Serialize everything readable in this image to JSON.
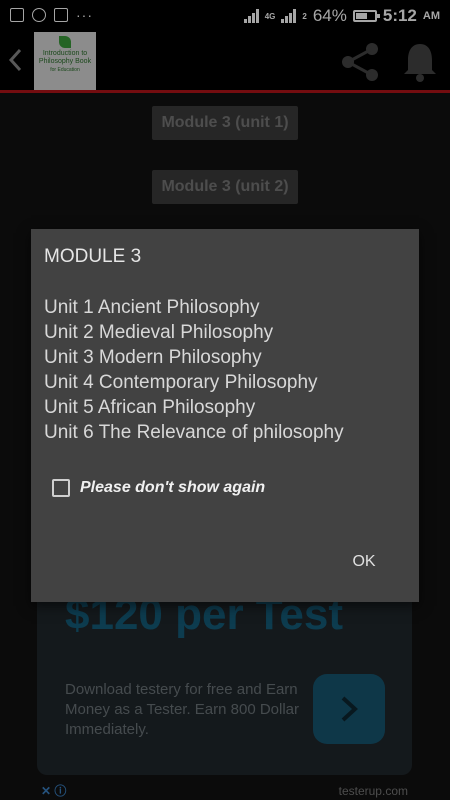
{
  "status_bar": {
    "battery": "64%",
    "time": "5:12",
    "ampm": "AM",
    "network": "4G",
    "sim2": "2",
    "overflow": "···",
    "battery_level": 0.64
  },
  "app_bar": {
    "back_icon": "chevron-left-icon",
    "thumbnail_text": "Introduction to Philosophy Book",
    "thumbnail_subtext": "for Education",
    "actions": [
      "share-icon",
      "bell-icon"
    ]
  },
  "buttons": [
    {
      "label": "Module 3 (unit 1)"
    },
    {
      "label": "Module 3 (unit 2)"
    }
  ],
  "ad": {
    "headline": "$120 per Test",
    "body": "Download testery for free and Earn Money as a Tester. Earn 800 Dollar Immediately.",
    "domain": "testerup.com",
    "ad_marks": "✕ ⓘ"
  },
  "dialog": {
    "title": "MODULE 3",
    "units": [
      "Unit 1 Ancient Philosophy",
      "Unit 2 Medieval Philosophy",
      "Unit 3 Modern Philosophy",
      "Unit 4 Contemporary Philosophy",
      "Unit 5 African Philosophy",
      "Unit 6 The Relevance of philosophy"
    ],
    "checkbox_label": "Please don't show again",
    "ok_label": "OK"
  },
  "colors": {
    "accent_red": "#b3141a",
    "dialog_bg": "#424242",
    "ad_blue": "#145d7a"
  }
}
